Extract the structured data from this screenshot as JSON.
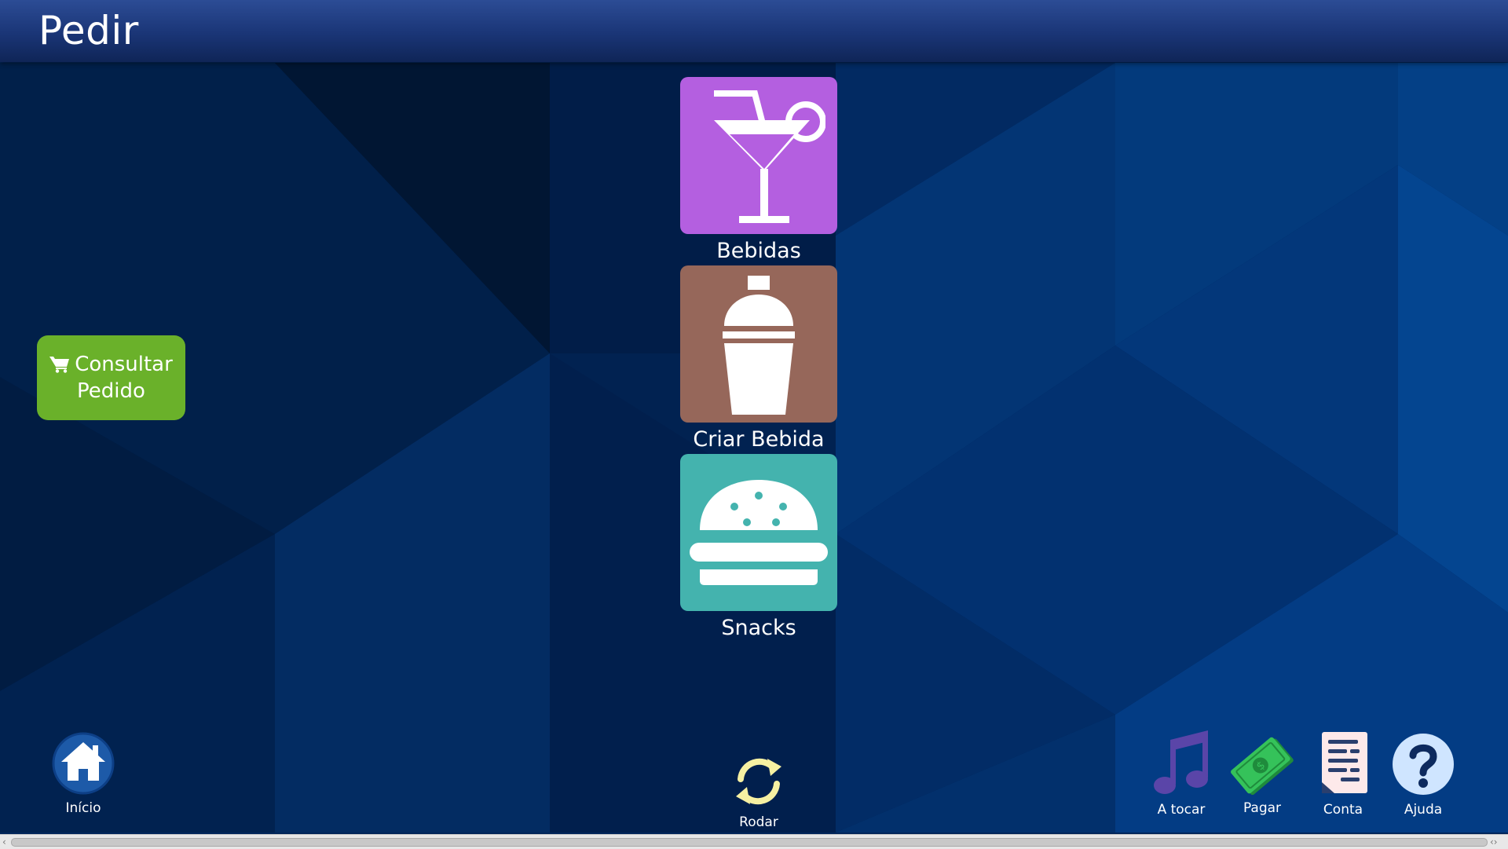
{
  "header": {
    "title": "Pedir"
  },
  "menu": {
    "tiles": [
      {
        "label": "Bebidas",
        "color": "#b45fe0",
        "icon": "cocktail-icon"
      },
      {
        "label": "Criar Bebida",
        "color": "#96675a",
        "icon": "shaker-icon"
      },
      {
        "label": "Snacks",
        "color": "#44b3ae",
        "icon": "burger-icon"
      }
    ]
  },
  "consultar": {
    "line1": "Consultar",
    "line2": "Pedido",
    "color": "#6ab12a",
    "icon": "cart-icon"
  },
  "nav": {
    "home": {
      "label": "Início",
      "icon": "home-icon"
    },
    "rotate": {
      "label": "Rodar",
      "icon": "rotate-icon"
    },
    "playing": {
      "label": "A tocar",
      "icon": "music-note-icon"
    },
    "pay": {
      "label": "Pagar",
      "icon": "money-icon"
    },
    "bill": {
      "label": "Conta",
      "icon": "receipt-icon"
    },
    "help": {
      "label": "Ajuda",
      "icon": "help-icon"
    }
  }
}
